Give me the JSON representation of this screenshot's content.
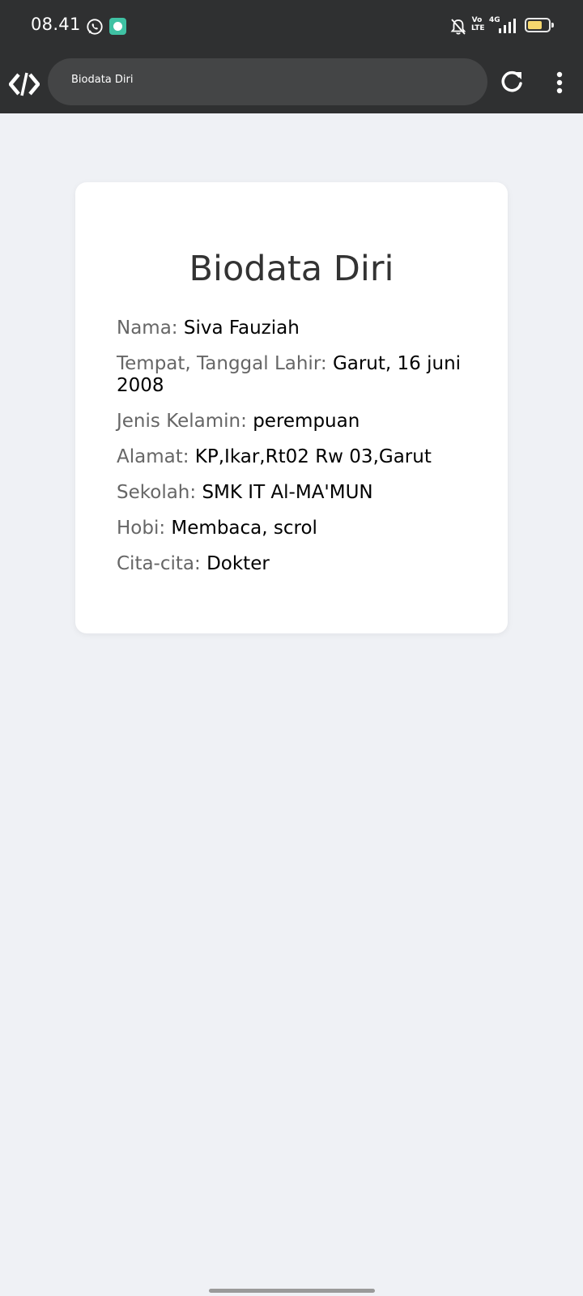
{
  "status_bar": {
    "time": "08.41",
    "volte": "Vo LTE",
    "network": "4G",
    "battery_level": 0.7
  },
  "browser": {
    "address": "Biodata Diri"
  },
  "card": {
    "title": "Biodata Diri",
    "rows": [
      {
        "label": "Nama:",
        "value": "Siva Fauziah"
      },
      {
        "label": "Tempat, Tanggal Lahir:",
        "value": "Garut, 16 juni 2008"
      },
      {
        "label": "Jenis Kelamin:",
        "value": "perempuan"
      },
      {
        "label": "Alamat:",
        "value": "KP,Ikar,Rt02 Rw 03,Garut"
      },
      {
        "label": "Sekolah:",
        "value": "SMK IT Al-MA'MUN"
      },
      {
        "label": "Hobi:",
        "value": "Membaca, scrol"
      },
      {
        "label": "Cita-cita:",
        "value": "Dokter"
      }
    ]
  },
  "colors": {
    "bar_background": "#2f3031",
    "page_background": "#eff1f5",
    "label": "#666666",
    "value": "#000000"
  }
}
